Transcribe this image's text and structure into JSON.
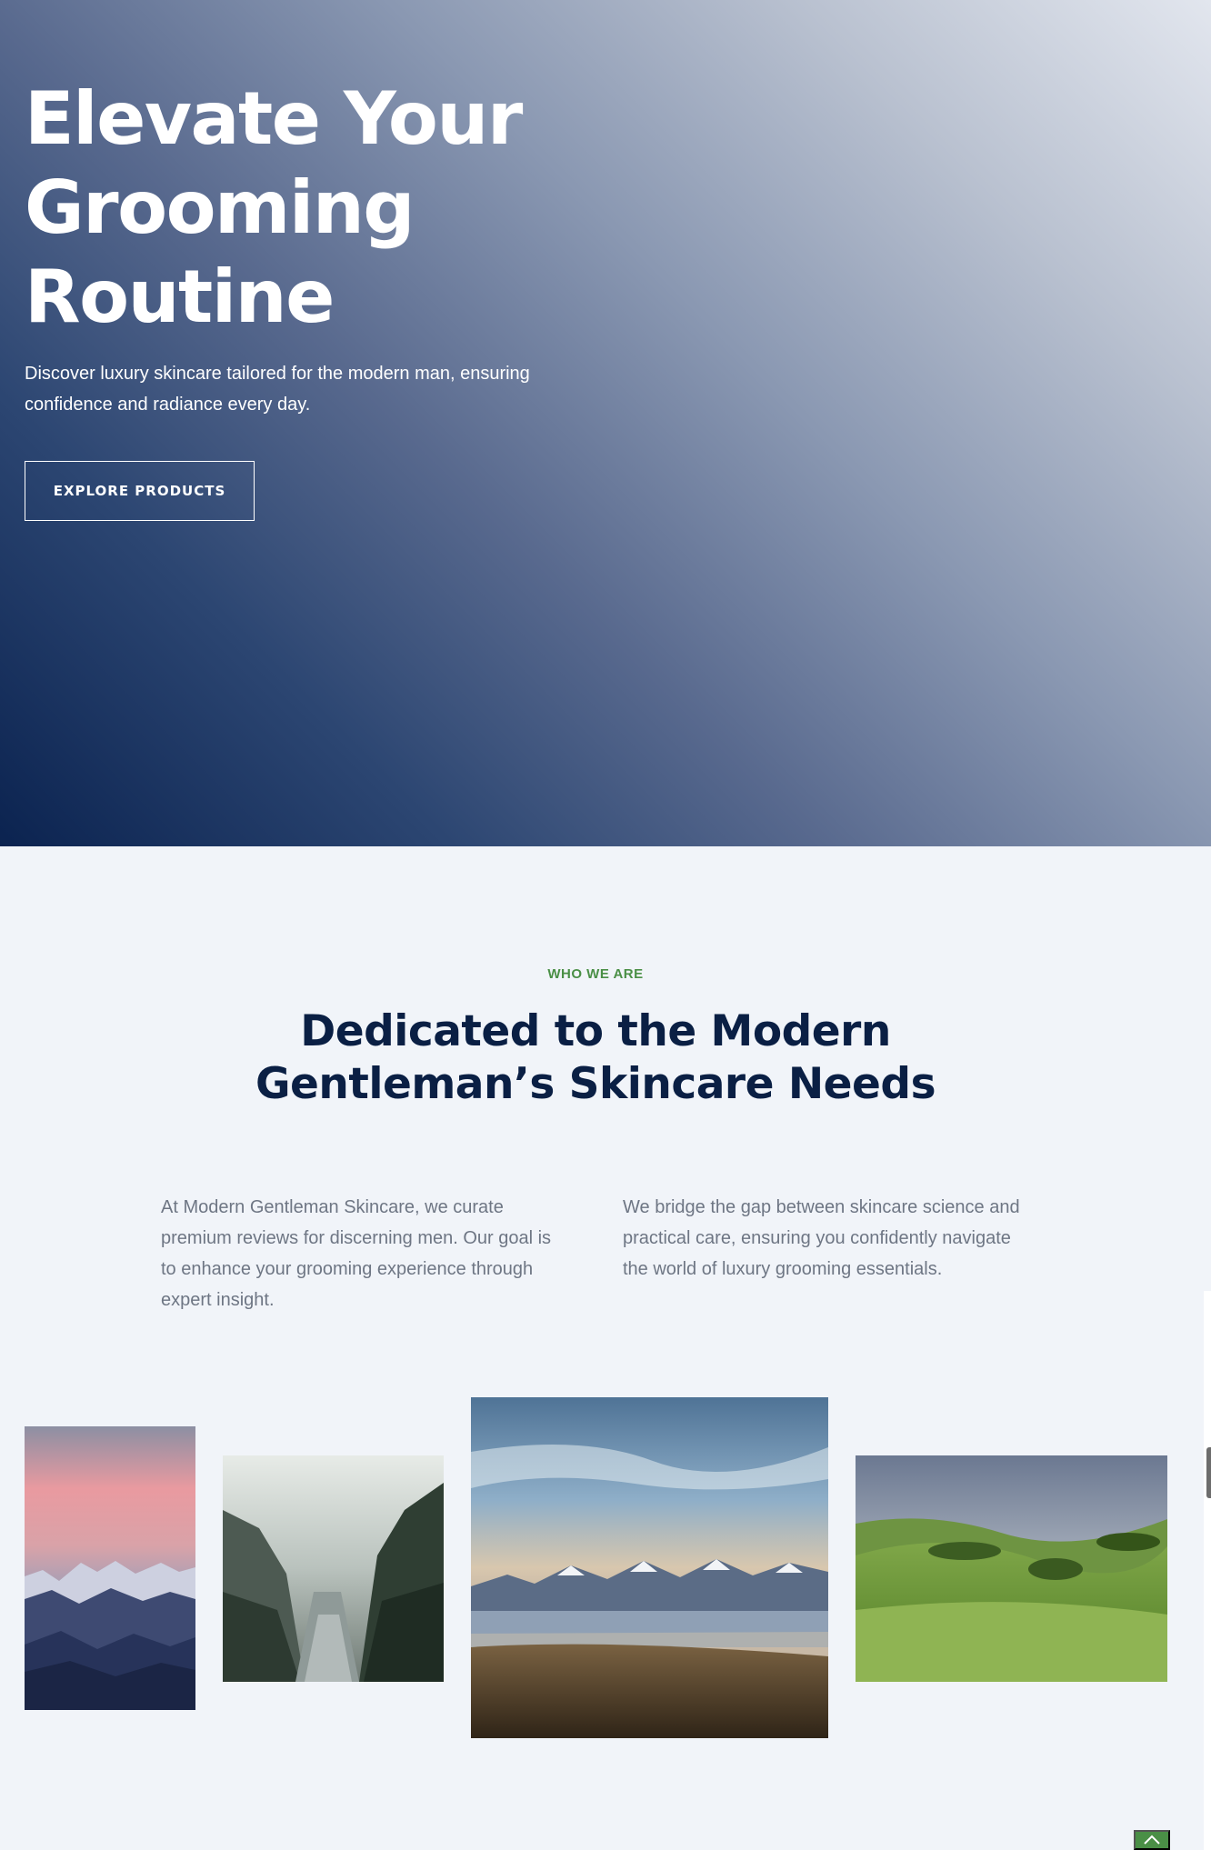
{
  "hero": {
    "title": "Elevate Your Grooming Routine",
    "subtitle": "Discover luxury skincare tailored for the modern man, ensuring confidence and radiance every day.",
    "cta_label": "EXPLORE PRODUCTS"
  },
  "about": {
    "eyebrow": "WHO WE ARE",
    "title": "Dedicated to the Modern Gentleman’s Skincare Needs",
    "paragraph_left": "At Modern Gentleman Skincare, we curate premium reviews for discerning men. Our goal is to enhance your grooming experience through expert insight.",
    "paragraph_right": "We bridge the gap between skincare science and practical care, ensuring you confidently navigate the world of luxury grooming essentials."
  },
  "gallery": [
    {
      "subject": "mountain-sunset-photo"
    },
    {
      "subject": "misty-forest-river-photo"
    },
    {
      "subject": "mountain-lake-photo"
    },
    {
      "subject": "green-hills-photo"
    }
  ],
  "widgets": {
    "scroll_top_icon": "chevron-up-icon",
    "accent_color": "#4a8f46",
    "navy_color": "#0a1f44"
  }
}
